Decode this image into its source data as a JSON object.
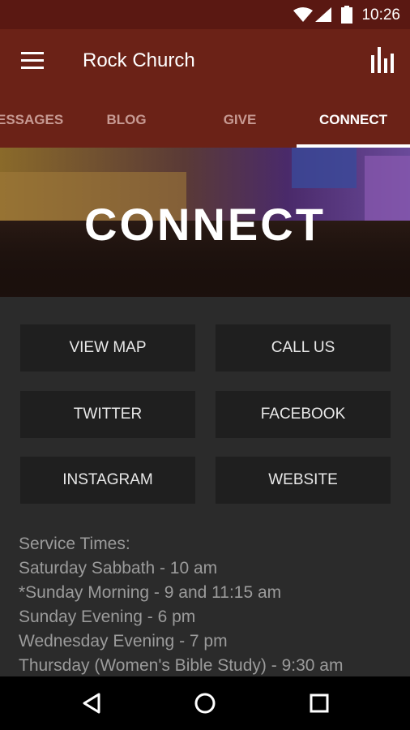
{
  "status": {
    "time": "10:26"
  },
  "appbar": {
    "title": "Rock Church"
  },
  "tabs": [
    {
      "label": "MESSAGES",
      "active": false
    },
    {
      "label": "BLOG",
      "active": false
    },
    {
      "label": "GIVE",
      "active": false
    },
    {
      "label": "CONNECT",
      "active": true
    }
  ],
  "hero": {
    "title": "CONNECT"
  },
  "buttons": {
    "view_map": "VIEW MAP",
    "call_us": "CALL US",
    "twitter": "TWITTER",
    "facebook": "FACEBOOK",
    "instagram": "INSTAGRAM",
    "website": "WEBSITE"
  },
  "service_times": {
    "heading": "Service Times:",
    "lines": [
      "Saturday Sabbath - 10 am",
      "*Sunday Morning - 9 and 11:15 am",
      "Sunday Evening - 6 pm",
      "Wednesday Evening - 7 pm",
      "Thursday (Women's Bible Study) - 9:30 am"
    ]
  },
  "colors": {
    "appbar": "#6b2217",
    "statusbar": "#5a1812",
    "content_bg": "#2b2b2b",
    "button_bg": "#1f1f1f"
  }
}
